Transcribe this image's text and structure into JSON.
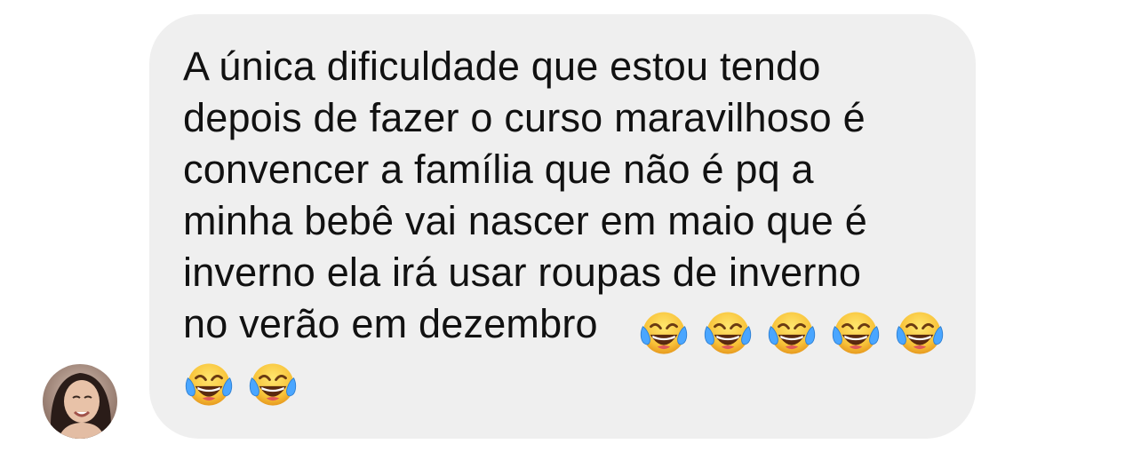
{
  "message": {
    "lines": [
      "A única dificuldade que estou tendo",
      "depois de fazer o curso maravilhoso é",
      "convencer a família que não é pq a",
      "minha bebê vai nascer em maio que é",
      "inverno ela irá usar roupas de inverno",
      "no verão em dezembro"
    ],
    "text": "A única dificuldade que estou tendo\ndepois de fazer o curso maravilhoso é\nconvencer a família que não é pq a\nminha bebê vai nascer em maio que é\ninverno ela irá usar roupas de inverno\nno verão em dezembro",
    "emoji_icon": "face-with-tears-of-joy-icon",
    "emoji_count": 7
  },
  "sender": {
    "avatar_icon": "avatar-photo"
  },
  "colors": {
    "bubble": "#efefef",
    "text": "#111111",
    "background": "#ffffff"
  }
}
